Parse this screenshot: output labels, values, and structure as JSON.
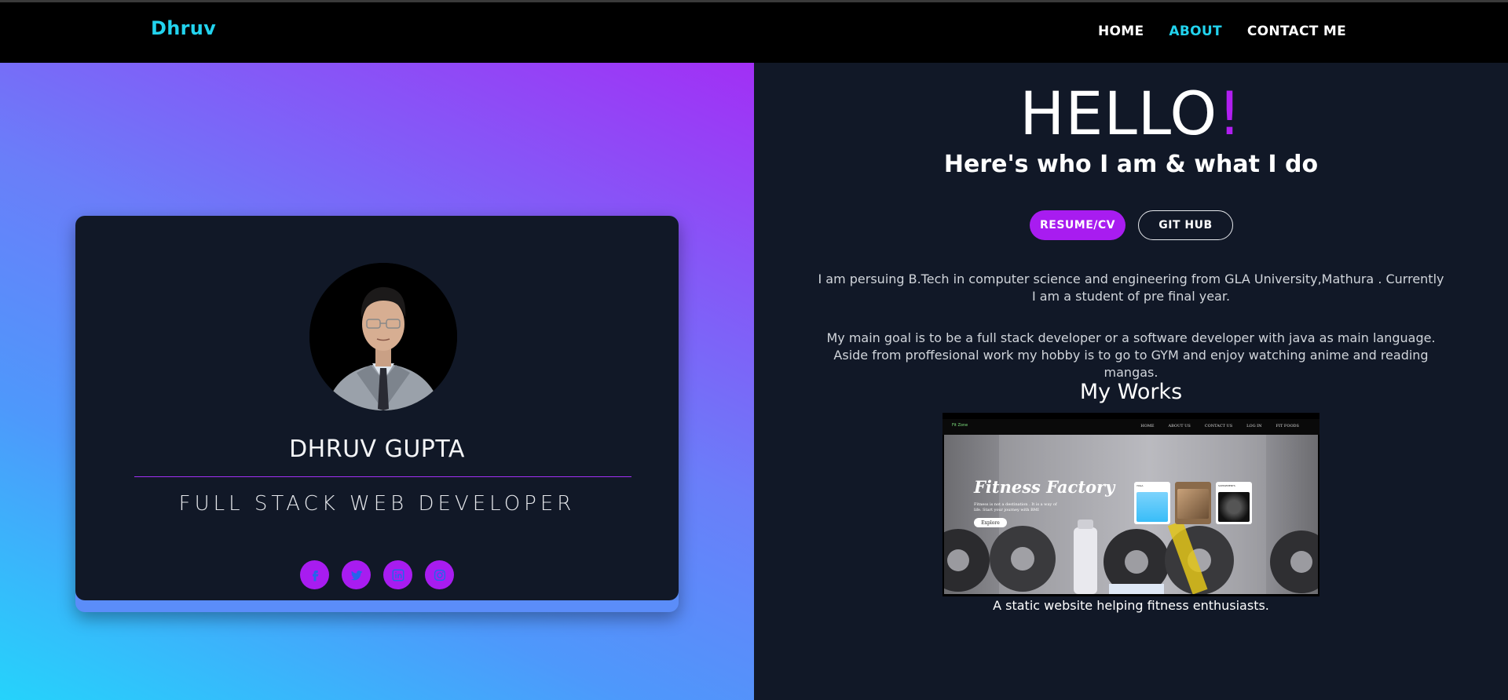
{
  "brand": "Dhruv",
  "nav": [
    "HOME",
    "ABOUT",
    "CONTACT ME"
  ],
  "nav_active": "ABOUT",
  "profile": {
    "name": "DHRUV GUPTA",
    "role": "FULL STACK WEB DEVELOPER",
    "socials": [
      "facebook-icon",
      "twitter-icon",
      "linkedin-icon",
      "instagram-icon"
    ]
  },
  "hero": {
    "hello": "HELLO",
    "bang": "!",
    "subtitle": "Here's who I am & what I do",
    "btn_resume": "RESUME/CV",
    "btn_github": "GIT HUB",
    "para1": "I am persuing B.Tech in computer science and engineering from GLA University,Mathura . Currently I am a student of pre final year.",
    "para2": "My main goal is to be a full stack developer or a software developer with java as main language. Aside from proffesional work my hobby is to go to GYM and enjoy watching anime and reading mangas."
  },
  "works": {
    "heading": "My Works",
    "caption": "A static website helping fitness enthusiasts.",
    "preview": {
      "logo": "Fit Zone",
      "links": [
        "HOME",
        "ABOUT US",
        "CONTACT US",
        "LOG IN",
        "FIT FOODS"
      ],
      "title": "Fitness Factory",
      "text": "Fitness is not a destination . It is a way of life. Start your journey with BMI",
      "button": "Explore",
      "cards": [
        "YOGA",
        "",
        "SUPPLEMENTS"
      ]
    }
  },
  "colors": {
    "accent": "#a81cf0",
    "brand": "#22d3ee",
    "panel": "#111827"
  }
}
